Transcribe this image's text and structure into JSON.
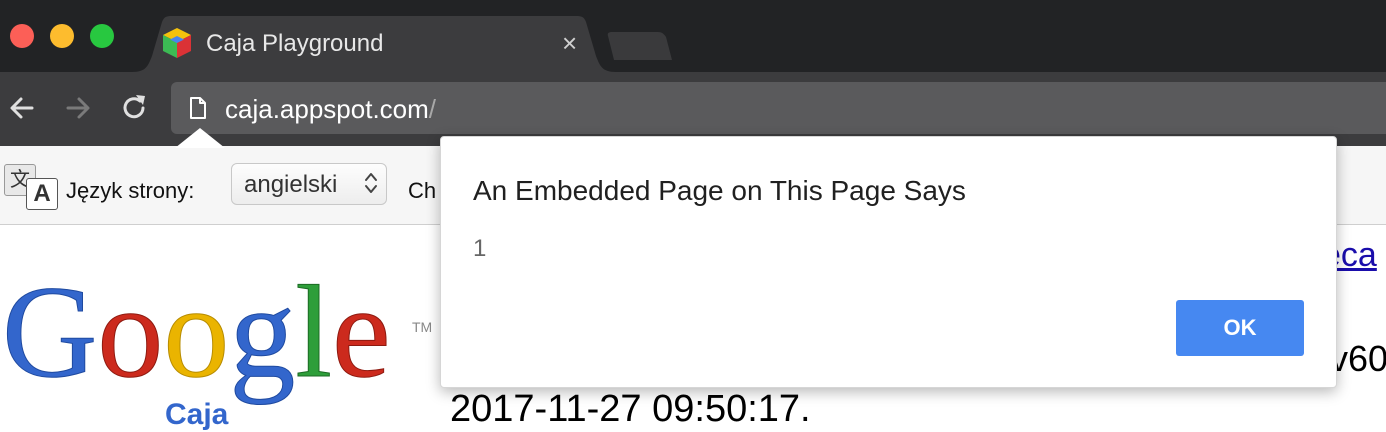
{
  "window": {
    "tab_title": "Caja Playground",
    "tab_close": "×"
  },
  "toolbar": {
    "url_host": "caja.appspot.com",
    "url_path": "/"
  },
  "translate_bar": {
    "icon_glyph_cjk": "文",
    "icon_glyph_latin": "A",
    "page_language_label": "Język strony:",
    "page_language_value": "angielski",
    "truncated_text": "Ch"
  },
  "page": {
    "logo_text": "Google",
    "logo_subtitle": "Caja",
    "trademark": "TM",
    "edge_link_text": "eca",
    "edge_version_text": "v60",
    "timestamp_text": "2017-11-27 09:50:17."
  },
  "dialog": {
    "title": "An Embedded Page on This Page Says",
    "message": "1",
    "ok_label": "OK"
  },
  "colors": {
    "ok_button": "#4688f1",
    "link": "#1a0dab"
  }
}
